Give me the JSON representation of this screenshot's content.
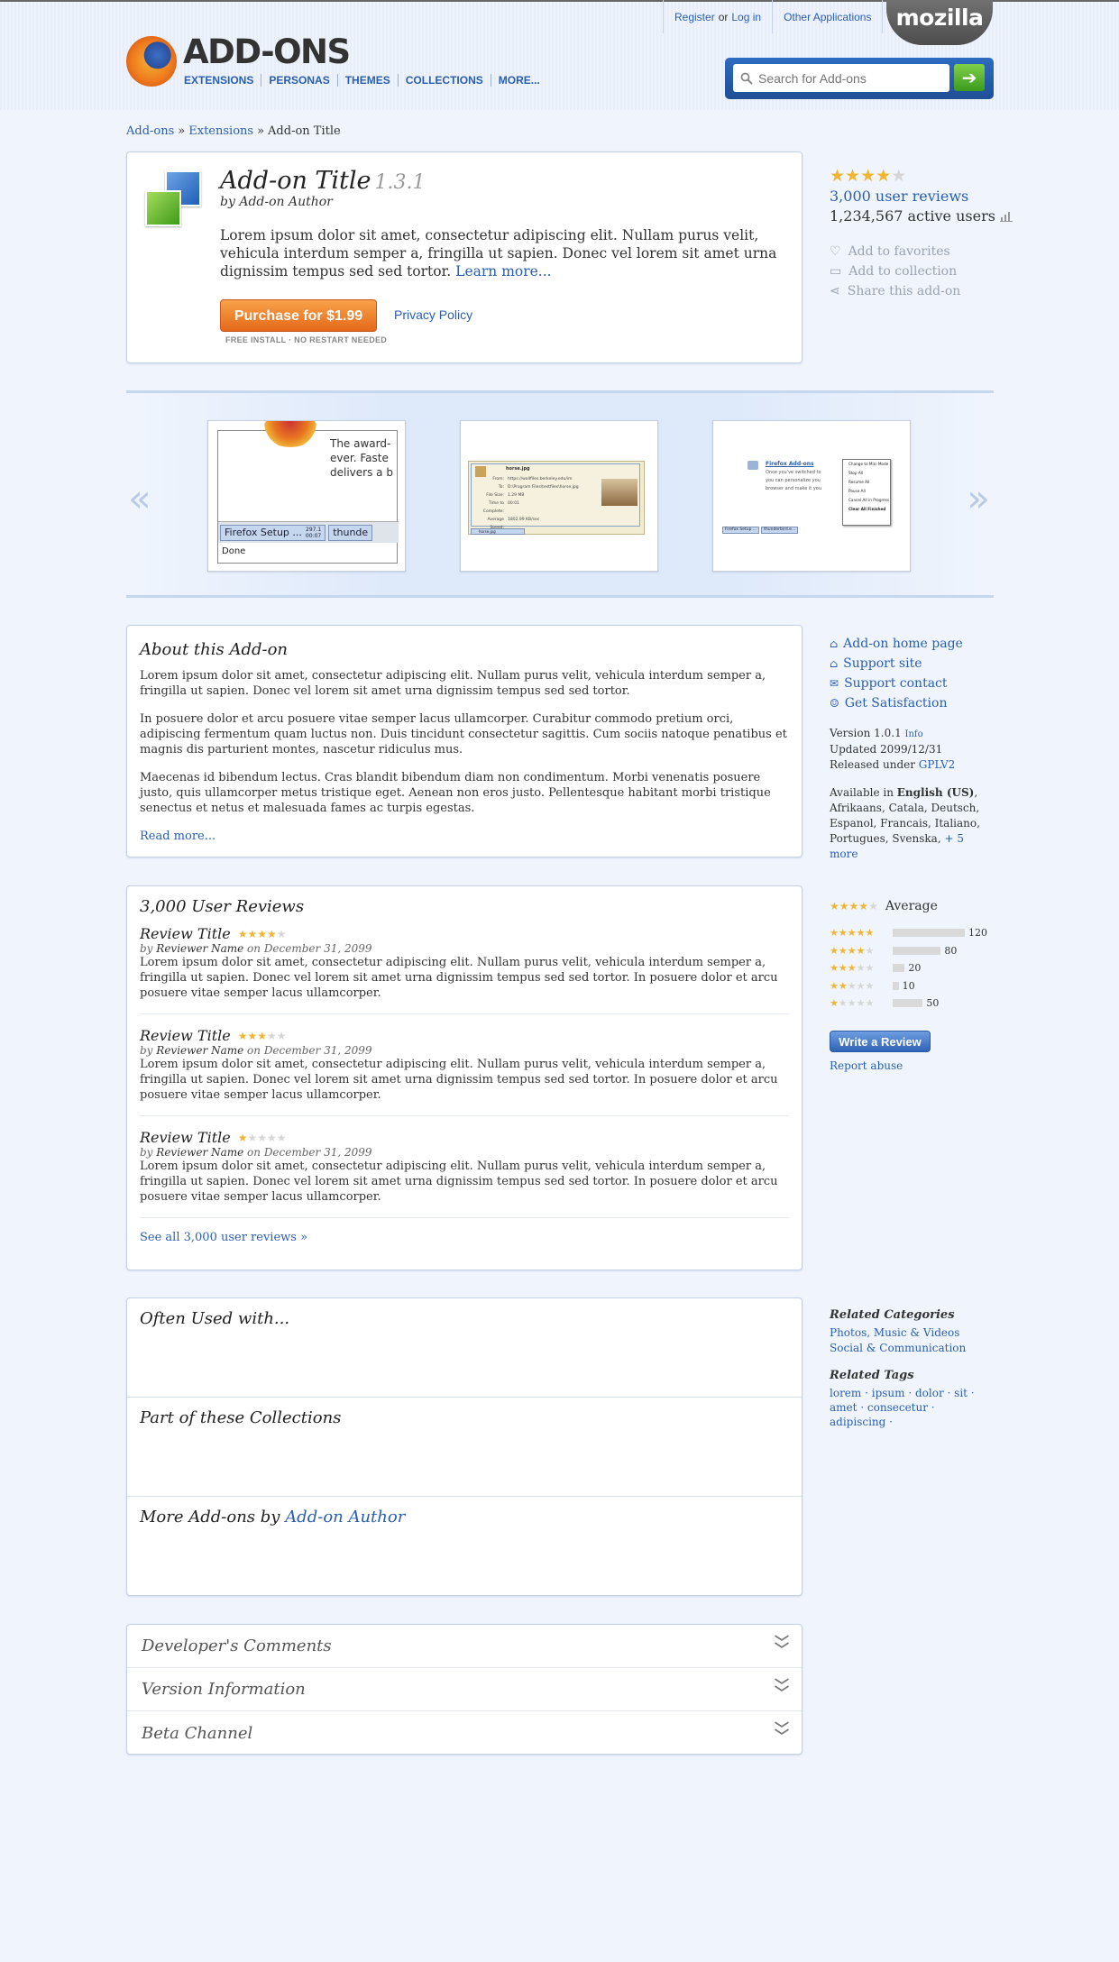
{
  "header": {
    "account": {
      "register": "Register",
      "or": "or",
      "login": "Log in",
      "other_apps": "Other Applications"
    },
    "mozilla": "mozilla",
    "brand": "ADD-ONS",
    "nav": [
      "EXTENSIONS",
      "PERSONAS",
      "THEMES",
      "COLLECTIONS",
      "MORE..."
    ],
    "search": {
      "placeholder": "Search for Add-ons"
    }
  },
  "breadcrumb": {
    "home": "Add-ons",
    "section": "Extensions",
    "current": "Add-on Title",
    "separator": "»"
  },
  "addon": {
    "title": "Add-on Title",
    "version": "1.3.1",
    "by_label": "by",
    "author": "Add-on Author",
    "description": "Lorem ipsum dolor sit amet, consectetur adipiscing elit. Nullam purus velit, vehicula interdum semper a, fringilla ut sapien. Donec vel lorem sit amet urna dignissim tempus sed sed tortor.",
    "learn_more": "Learn more...",
    "purchase_label": "Purchase for $1.99",
    "privacy": "Privacy Policy",
    "install_note": "FREE INSTALL · NO RESTART NEEDED"
  },
  "summary": {
    "rating": 4,
    "reviews_link": "3,000 user reviews",
    "users_count": "1,234,567",
    "users_label": "active users",
    "actions": [
      "Add to favorites",
      "Add to collection",
      "Share this add-on"
    ]
  },
  "carousel": {
    "prev": "«",
    "next": "»",
    "thumb1": {
      "text": "The award-\never. Faste\ndelivers a b",
      "taskbar1": "Firefox Setup ...",
      "taskbar_size": "297.1",
      "taskbar_time": "00:07",
      "taskbar2": "thunde",
      "status": "Done"
    },
    "thumb2": {
      "file": "horse.jpg",
      "rows": [
        [
          "From:",
          "https://wallfiles.berkeley.edu/im"
        ],
        [
          "To:",
          "D:\\Program Files\\testfiles\\horse.jpg"
        ],
        [
          "File Size:",
          "1.29 MB"
        ],
        [
          "Time to Complete:",
          "00:01"
        ],
        [
          "Average Speed:",
          "1802.99 KB/sec"
        ]
      ],
      "tab": "horse.jpg"
    },
    "thumb3": {
      "link": "Firefox Add-ons",
      "lines": [
        "Once you've switched to",
        "you can personalize you",
        "browser and make it you"
      ],
      "menu": [
        "Change to Mini Mode",
        "Stop All",
        "Resume All",
        "Pause All",
        "Cancel All in Progress",
        "Clear All Finished"
      ],
      "task1": "Firefox Setup ...",
      "task2": "thunderbird.e..."
    }
  },
  "about": {
    "heading": "About this Add-on",
    "paragraphs": [
      "Lorem ipsum dolor sit amet, consectetur adipiscing elit. Nullam purus velit, vehicula interdum semper a, fringilla ut sapien. Donec vel lorem sit amet urna dignissim tempus sed sed tortor.",
      "In posuere dolor et arcu posuere vitae semper lacus ullamcorper. Curabitur commodo pretium orci, adipiscing fermentum quam luctus non. Duis tincidunt consectetur sagittis. Cum sociis natoque penatibus et magnis dis parturient montes, nascetur ridiculus mus.",
      "Maecenas id bibendum lectus. Cras blandit bibendum diam non condimentum. Morbi venenatis posuere justo, quis ullamcorper metus tristique eget. Aenean non eros justo. Pellentesque habitant morbi tristique senectus et netus et malesuada fames ac turpis egestas."
    ],
    "read_more": "Read more..."
  },
  "about_side": {
    "links": [
      "Add-on home page",
      "Support site",
      "Support contact",
      "Get Satisfaction"
    ],
    "version_label": "Version 1.0.1",
    "version_info": "Info",
    "updated": "Updated 2099/12/31",
    "released_label": "Released under",
    "license": "GPLV2",
    "available_label": "Available in",
    "available_primary": "English (US)",
    "available_rest": ", Afrikaans, Catala, Deutsch, Espanol, Francais, Italiano, Portugues, Svenska,",
    "more_langs": "+ 5 more"
  },
  "reviews": {
    "heading": "3,000 User Reviews",
    "items": [
      {
        "title": "Review Title",
        "rating": 4,
        "by": "by",
        "name": "Reviewer Name",
        "on": "on December 31, 2099",
        "text": "Lorem ipsum dolor sit amet, consectetur adipiscing elit. Nullam purus velit, vehicula interdum semper a, fringilla ut sapien. Donec vel lorem sit amet urna dignissim tempus sed sed tortor. In posuere dolor et arcu posuere vitae semper lacus ullamcorper."
      },
      {
        "title": "Review Title",
        "rating": 3,
        "by": "by",
        "name": "Reviewer Name",
        "on": "on December 31, 2099",
        "text": "Lorem ipsum dolor sit amet, consectetur adipiscing elit. Nullam purus velit, vehicula interdum semper a, fringilla ut sapien. Donec vel lorem sit amet urna dignissim tempus sed sed tortor. In posuere dolor et arcu posuere vitae semper lacus ullamcorper."
      },
      {
        "title": "Review Title",
        "rating": 1,
        "by": "by",
        "name": "Reviewer Name",
        "on": "on December 31, 2099",
        "text": "Lorem ipsum dolor sit amet, consectetur adipiscing elit. Nullam purus velit, vehicula interdum semper a, fringilla ut sapien. Donec vel lorem sit amet urna dignissim tempus sed sed tortor. In posuere dolor et arcu posuere vitae semper lacus ullamcorper."
      }
    ],
    "see_all": "See all 3,000 user reviews »"
  },
  "rating_summary": {
    "average_rating": 4,
    "average_label": "Average",
    "bars": [
      {
        "stars": 5,
        "count": "120",
        "value": 120
      },
      {
        "stars": 4,
        "count": "80",
        "value": 80
      },
      {
        "stars": 3,
        "count": "20",
        "value": 20
      },
      {
        "stars": 2,
        "count": "10",
        "value": 10
      },
      {
        "stars": 1,
        "count": "50",
        "value": 50
      }
    ],
    "write_review": "Write a Review",
    "report_abuse": "Report abuse"
  },
  "more": {
    "often_used": "Often Used with...",
    "collections": "Part of these Collections",
    "more_by_prefix": "More Add-ons by",
    "more_by_author": "Add-on Author"
  },
  "related": {
    "categories_heading": "Related Categories",
    "categories": [
      "Photos, Music & Videos",
      "Social & Communication"
    ],
    "tags_heading": "Related Tags",
    "tags": [
      "lorem",
      "ipsum",
      "dolor",
      "sit",
      "amet",
      "consecetur",
      "adipiscing"
    ]
  },
  "accordion": [
    "Developer's Comments",
    "Version Information",
    "Beta Channel"
  ],
  "colors": {
    "accent": "#2a5fb0",
    "purchase": "#e97524",
    "star": "#f0b531",
    "background": "#f0f5fd"
  }
}
